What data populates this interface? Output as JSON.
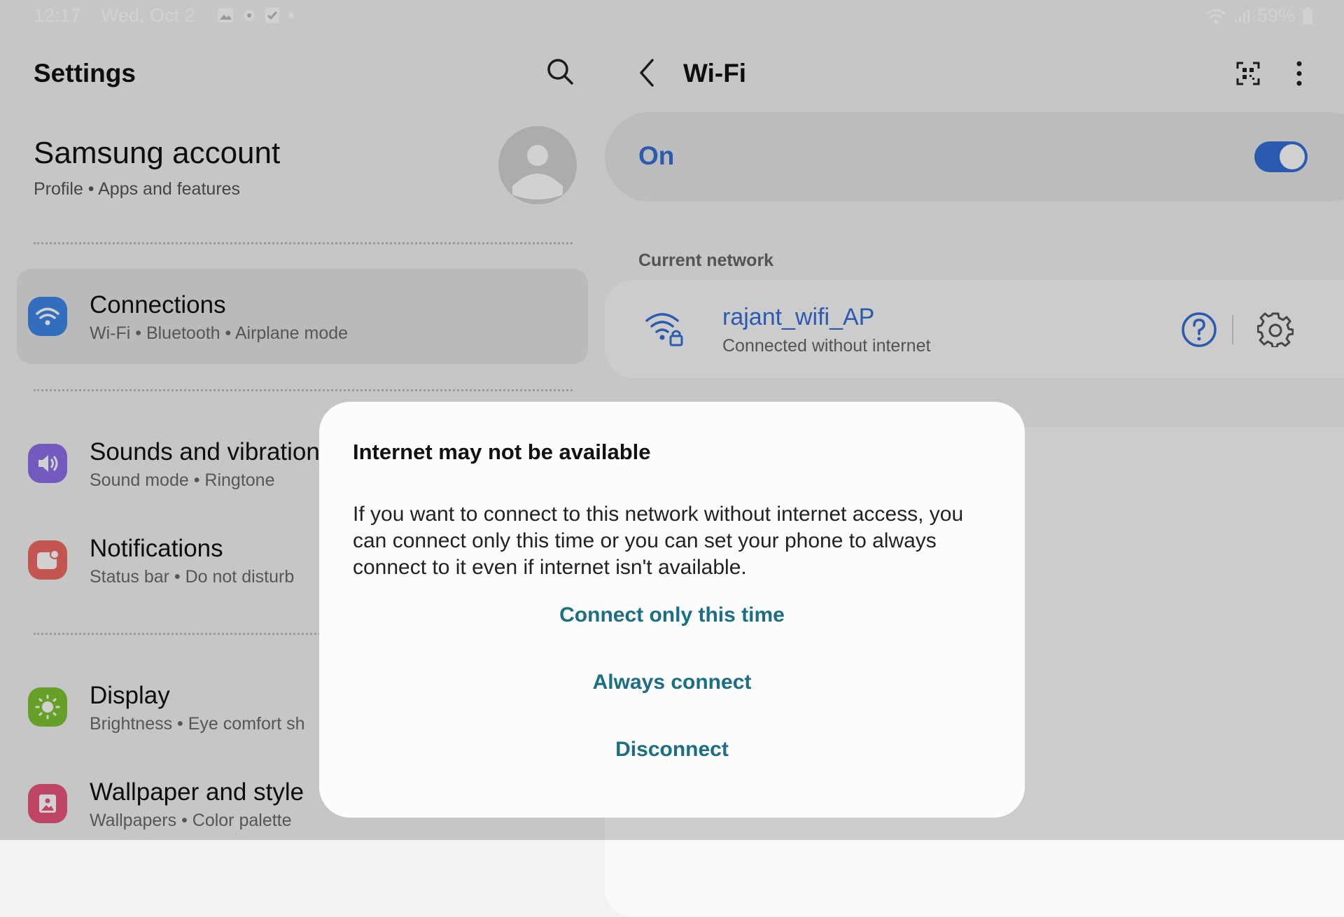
{
  "status_bar": {
    "time": "12:17",
    "date": "Wed, Oct 2",
    "battery": "59%",
    "left_icons": [
      "gallery-icon",
      "settings-icon",
      "checkbox-icon",
      "dot-icon"
    ],
    "right_icons": [
      "wifi-icon",
      "signal-icon",
      "battery-icon"
    ]
  },
  "left_pane": {
    "title": "Settings",
    "account": {
      "name": "Samsung account",
      "sub": "Profile  •  Apps and features"
    },
    "items": [
      {
        "title": "Connections",
        "sub": "Wi-Fi  •  Bluetooth  •  Airplane mode",
        "icon": "wifi-icon",
        "color": "#3e86e8"
      },
      {
        "title": "Sounds and vibration",
        "sub": "Sound mode  •  Ringtone",
        "icon": "speaker-icon",
        "color": "#8c6ee8"
      },
      {
        "title": "Notifications",
        "sub": "Status bar  •  Do not disturb",
        "icon": "notification-icon",
        "color": "#ee6a62"
      },
      {
        "title": "Display",
        "sub": "Brightness  •  Eye comfort sh",
        "icon": "sun-icon",
        "color": "#7dc433"
      },
      {
        "title": "Wallpaper and style",
        "sub": "Wallpapers  •  Color palette",
        "icon": "image-icon",
        "color": "#e8557a"
      }
    ]
  },
  "right_pane": {
    "title": "Wi-Fi",
    "toggle_label": "On",
    "toggle_on": true,
    "current_network_label": "Current network",
    "network": {
      "name": "rajant_wifi_AP",
      "status": "Connected without internet"
    },
    "accent_color": "#3470d8"
  },
  "dialog": {
    "title": "Internet may not be available",
    "body": "If you want to connect to this network without internet access, you can connect only this time or you can set your phone to always connect to it even if internet isn't available.",
    "buttons": {
      "connect_once": "Connect only this time",
      "always": "Always connect",
      "disconnect": "Disconnect"
    },
    "button_color": "#1a6f86"
  }
}
